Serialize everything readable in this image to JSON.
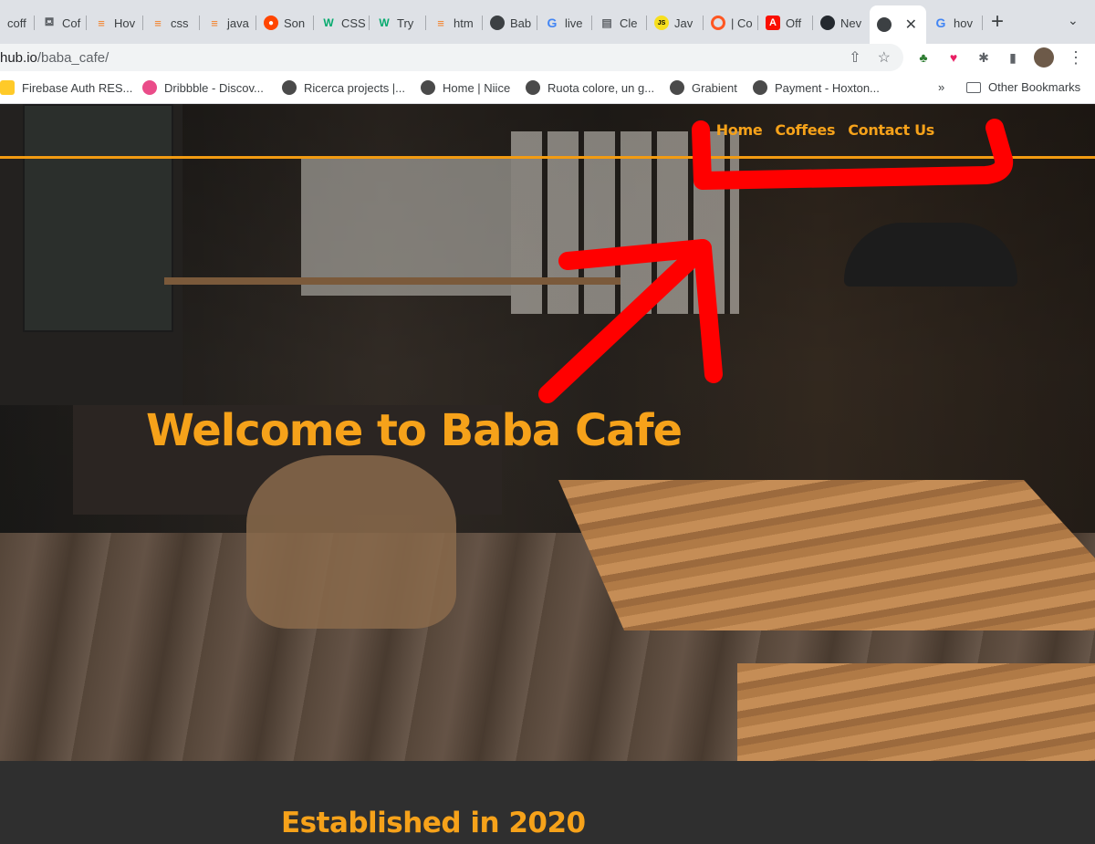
{
  "browser": {
    "tabs": [
      {
        "title": "coff",
        "icon": "page-icon",
        "color": "#9aa0a6"
      },
      {
        "title": "Cof",
        "icon": "cup-icon",
        "color": "#5f6368"
      },
      {
        "title": "Hov",
        "icon": "stackoverflow-icon",
        "color": "#f48024"
      },
      {
        "title": "css",
        "icon": "stackoverflow-icon",
        "color": "#f48024"
      },
      {
        "title": "java",
        "icon": "stackoverflow-icon",
        "color": "#f48024"
      },
      {
        "title": "Son",
        "icon": "reddit-icon",
        "color": "#ff4500"
      },
      {
        "title": "CSS",
        "icon": "w3schools-icon",
        "color": "#04aa6d"
      },
      {
        "title": "Try",
        "icon": "w3schools-icon",
        "color": "#04aa6d"
      },
      {
        "title": "htm",
        "icon": "stackoverflow-icon",
        "color": "#f48024"
      },
      {
        "title": "Bab",
        "icon": "globe-icon",
        "color": "#3c4043"
      },
      {
        "title": "live",
        "icon": "google-icon",
        "color": "#4285f4"
      },
      {
        "title": "Cle",
        "icon": "page-icon",
        "color": "#9aa0a6"
      },
      {
        "title": "Jav",
        "icon": "js-icon",
        "color": "#f7df1e"
      },
      {
        "title": "| Co",
        "icon": "ring-icon",
        "color": "#ff5722"
      },
      {
        "title": "Off",
        "icon": "adobe-icon",
        "color": "#fa0f00"
      },
      {
        "title": "Nev",
        "icon": "github-icon",
        "color": "#24292f"
      },
      {
        "title": "",
        "icon": "globe-icon",
        "color": "#3c4043",
        "active": true
      },
      {
        "title": "hov",
        "icon": "google-icon",
        "color": "#4285f4"
      }
    ],
    "close_symbol": "✕",
    "new_tab_symbol": "+",
    "tab_menu_symbol": "⌄",
    "address": {
      "host": "hub.io",
      "path": "/baba_cafe/"
    },
    "bookmarks": [
      {
        "label": "Firebase Auth RES...",
        "icon": "hand-icon"
      },
      {
        "label": "Dribbble - Discov...",
        "icon": "dribbble-icon"
      },
      {
        "label": "Ricerca projects |...",
        "icon": "globe-icon"
      },
      {
        "label": "Home | Niice",
        "icon": "globe-icon"
      },
      {
        "label": "Ruota colore, un g...",
        "icon": "globe-icon"
      },
      {
        "label": "Grabient",
        "icon": "globe-icon"
      },
      {
        "label": "Payment - Hoxton...",
        "icon": "globe-icon"
      }
    ],
    "bookmarks_overflow": "»",
    "other_bookmarks": "Other Bookmarks"
  },
  "site": {
    "nav": [
      "Home",
      "Coffees",
      "Contact Us"
    ],
    "hero_title": "Welcome to Baba Cafe",
    "section_title": "Established in 2020",
    "accent": "#f6a21a",
    "annotation_color": "#ff0000"
  }
}
